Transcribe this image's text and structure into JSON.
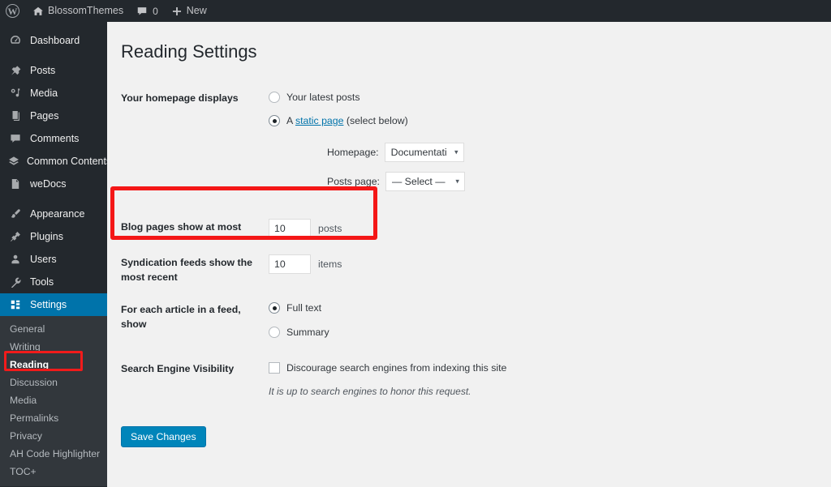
{
  "adminbar": {
    "wp_logo": "wordpress-logo",
    "site_name": "BlossomThemes",
    "comments_count": "0",
    "new_label": "New"
  },
  "sidebar": {
    "items": [
      {
        "label": "Dashboard",
        "icon": "dashboard-icon",
        "group": 1
      },
      {
        "label": "Posts",
        "icon": "pin-icon",
        "group": 2
      },
      {
        "label": "Media",
        "icon": "media-icon",
        "group": 2
      },
      {
        "label": "Pages",
        "icon": "pages-icon",
        "group": 2
      },
      {
        "label": "Comments",
        "icon": "comment-icon",
        "group": 2
      },
      {
        "label": "Common Contents",
        "icon": "layers-icon",
        "group": 2
      },
      {
        "label": "weDocs",
        "icon": "document-icon",
        "group": 2
      },
      {
        "label": "Appearance",
        "icon": "brush-icon",
        "group": 3
      },
      {
        "label": "Plugins",
        "icon": "plug-icon",
        "group": 3
      },
      {
        "label": "Users",
        "icon": "user-icon",
        "group": 3
      },
      {
        "label": "Tools",
        "icon": "wrench-icon",
        "group": 3
      },
      {
        "label": "Settings",
        "icon": "settings-icon",
        "group": 3,
        "active": true
      }
    ],
    "submenu": [
      {
        "label": "General"
      },
      {
        "label": "Writing"
      },
      {
        "label": "Reading",
        "current": true
      },
      {
        "label": "Discussion"
      },
      {
        "label": "Media"
      },
      {
        "label": "Permalinks"
      },
      {
        "label": "Privacy"
      },
      {
        "label": "AH Code Highlighter"
      },
      {
        "label": "TOC+"
      }
    ]
  },
  "page": {
    "title": "Reading Settings"
  },
  "form": {
    "homepage_display": {
      "label": "Your homepage displays",
      "option_latest": "Your latest posts",
      "option_static_prefix": "A ",
      "option_static_link": "static page",
      "option_static_suffix": " (select below)",
      "selected": "static",
      "homepage_label": "Homepage:",
      "homepage_value": "Documentation",
      "posts_page_label": "Posts page:",
      "posts_page_value": "— Select —"
    },
    "blog_pages": {
      "label": "Blog pages show at most",
      "value": "10",
      "unit": "posts"
    },
    "syndication": {
      "label": "Syndication feeds show the most recent",
      "value": "10",
      "unit": "items"
    },
    "feed_article": {
      "label": "For each article in a feed, show",
      "option_full": "Full text",
      "option_summary": "Summary",
      "selected": "full"
    },
    "search_visibility": {
      "label": "Search Engine Visibility",
      "checkbox_label": "Discourage search engines from indexing this site",
      "checked": false,
      "hint": "It is up to search engines to honor this request."
    },
    "save_label": "Save Changes"
  },
  "annotations": {
    "highlight_color": "#f41717",
    "highlight_reading": "Reading",
    "highlight_blog_row": "Blog pages show at most"
  },
  "colors": {
    "admin_blue": "#0073aa",
    "sidebar_bg": "#23282d",
    "submenu_bg": "#32373c",
    "content_bg": "#f1f1f1",
    "button_blue": "#0085ba"
  }
}
